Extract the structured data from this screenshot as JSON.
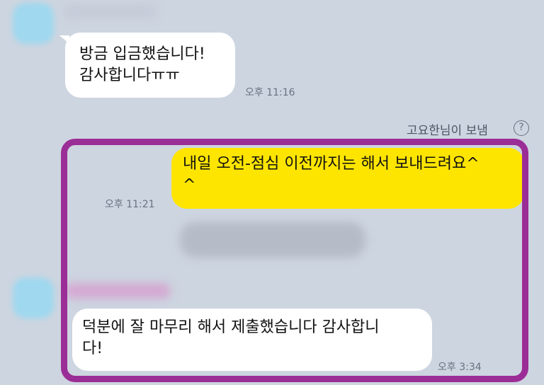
{
  "chat": {
    "received_1": {
      "text": "방금 입금했습니다!\n감사합니다ㅠㅠ",
      "time": "오후 11:16"
    },
    "sent_label": "고요한님이 보냄",
    "help_icon": "question-circle-icon",
    "sent_1": {
      "text": "내일 오전-점심 이전까지는 해서 보내드려요^\n^",
      "time": "오후 11:21"
    },
    "received_2": {
      "text": "덕분에 잘 마무리 해서 제출했습니다 감사합니\n다!",
      "time": "오후 3:34"
    }
  },
  "colors": {
    "background": "#cdd5e0",
    "sent_bubble": "#fee500",
    "received_bubble": "#ffffff",
    "highlight_frame": "#9b2d96"
  }
}
